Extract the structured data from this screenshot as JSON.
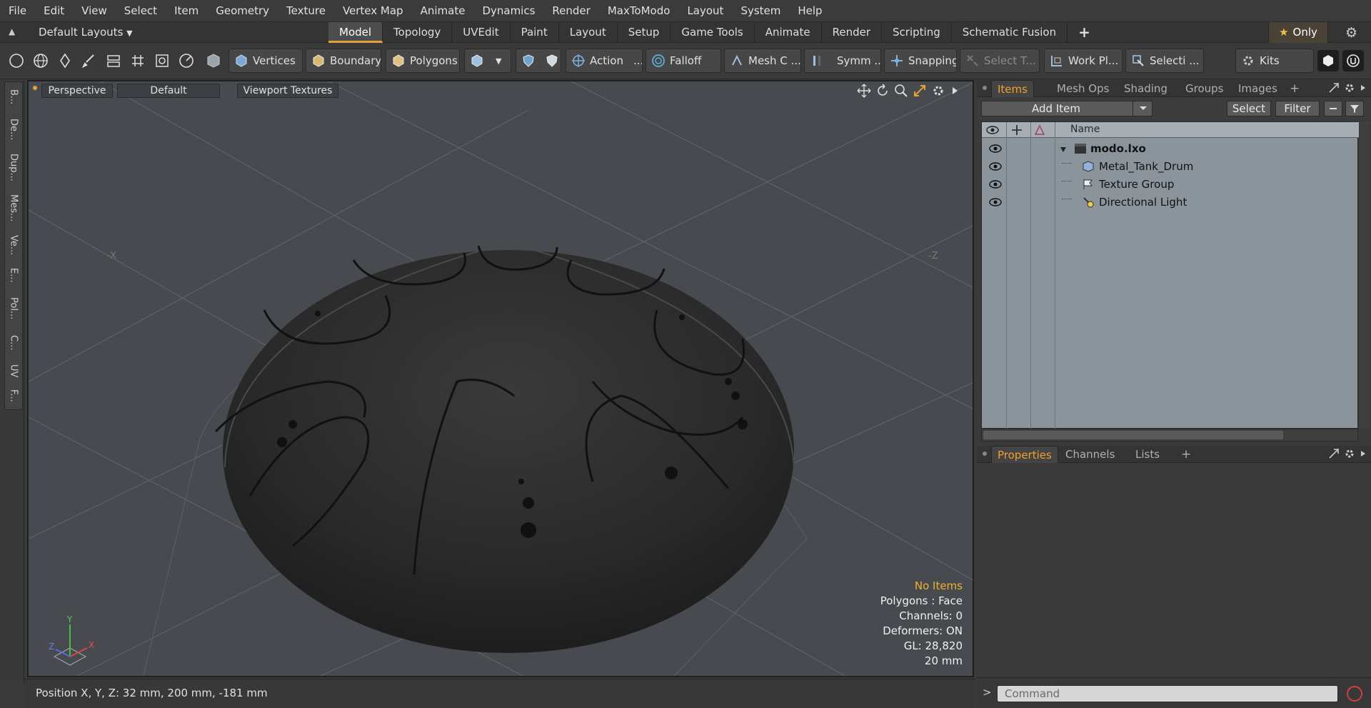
{
  "menu": [
    "File",
    "Edit",
    "View",
    "Select",
    "Item",
    "Geometry",
    "Texture",
    "Vertex Map",
    "Animate",
    "Dynamics",
    "Render",
    "MaxToModo",
    "Layout",
    "System",
    "Help"
  ],
  "layout_bar": {
    "layouts_label": "Default Layouts",
    "tabs": [
      "Model",
      "Topology",
      "UVEdit",
      "Paint",
      "Layout",
      "Setup",
      "Game Tools",
      "Animate",
      "Render",
      "Scripting",
      "Schematic Fusion"
    ],
    "active_tab": "Model",
    "only_label": "Only"
  },
  "toolbar": {
    "vertices": "Vertices",
    "boundary": "Boundary",
    "polygons": "Polygons",
    "action": "Action",
    "action_more": "...",
    "falloff": "Falloff",
    "mesh_c": "Mesh C ...",
    "symm": "Symm ...",
    "snapping": "Snapping",
    "select_t": "Select T...",
    "work_pl": "Work Pl...",
    "selecti": "Selecti ...",
    "kits": "Kits"
  },
  "left_tabs": [
    "B...",
    "De...",
    "Dup...",
    "Mes...",
    "Ve...",
    "E...",
    "Pol...",
    "C...",
    "UV",
    "F..."
  ],
  "viewport": {
    "perspective": "Perspective",
    "default": "Default",
    "textures": "Viewport Textures",
    "axis_x_label": "-X",
    "axis_z_label": "-Z",
    "stats": {
      "no_items": "No Items",
      "polygons": "Polygons : Face",
      "channels": "Channels: 0",
      "deformers": "Deformers: ON",
      "gl": "GL: 28,820",
      "scale": "20 mm"
    },
    "gizmo": {
      "y": "Y",
      "x": "X",
      "z": "Z"
    }
  },
  "status": {
    "position": "Position X, Y, Z:   32 mm, 200 mm, -181 mm"
  },
  "items_panel": {
    "tabs": [
      "Items",
      "Mesh Ops",
      "Shading",
      "Groups",
      "Images"
    ],
    "active_tab": "Items",
    "add_item": "Add Item",
    "select": "Select",
    "filter": "Filter",
    "column_name": "Name",
    "tree": [
      {
        "label": "modo.lxo",
        "bold": true,
        "icon": "scene-clapper-icon"
      },
      {
        "label": "Metal_Tank_Drum",
        "bold": false,
        "icon": "mesh-cube-icon"
      },
      {
        "label": "Texture Group",
        "bold": false,
        "icon": "texture-group-icon"
      },
      {
        "label": "Directional Light",
        "bold": false,
        "icon": "light-icon"
      }
    ]
  },
  "props_panel": {
    "tabs": [
      "Properties",
      "Channels",
      "Lists"
    ],
    "active_tab": "Properties"
  },
  "command": {
    "prompt": ">",
    "placeholder": "Command"
  },
  "colors": {
    "accent": "#e8a03a",
    "viewport_bg": "#474b4f",
    "tree_bg": "#8b949b",
    "highlight_text": "#f0b030"
  }
}
